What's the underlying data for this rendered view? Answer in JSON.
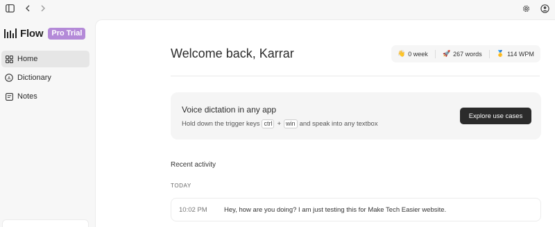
{
  "topbar": {
    "icons": [
      "sidebar-toggle-icon",
      "back-icon",
      "forward-icon",
      "settings-icon",
      "account-icon"
    ]
  },
  "brand": {
    "name": "Flow",
    "badge": "Pro Trial",
    "badge_color": "#b48ad8"
  },
  "sidebar": {
    "items": [
      {
        "label": "Home",
        "icon": "home-grid-icon",
        "active": true
      },
      {
        "label": "Dictionary",
        "icon": "dictionary-icon",
        "active": false
      },
      {
        "label": "Notes",
        "icon": "notes-icon",
        "active": false
      }
    ]
  },
  "main": {
    "welcome": "Welcome back, Karrar",
    "stats": [
      {
        "emoji": "👋",
        "text": "0 week"
      },
      {
        "emoji": "🚀",
        "text": "267 words"
      },
      {
        "emoji": "🥇",
        "text": "114 WPM"
      }
    ],
    "promo": {
      "title": "Voice dictation in any app",
      "sub_before": "Hold down the trigger keys",
      "key1": "ctrl",
      "plus": "+",
      "key2": "win",
      "sub_after": "and speak into any textbox",
      "button": "Explore use cases"
    },
    "recent_title": "Recent activity",
    "group_label": "TODAY",
    "activity": [
      {
        "time": "10:02 PM",
        "text": "Hey, how are you doing? I am just testing this for Make Tech Easier website."
      }
    ]
  }
}
